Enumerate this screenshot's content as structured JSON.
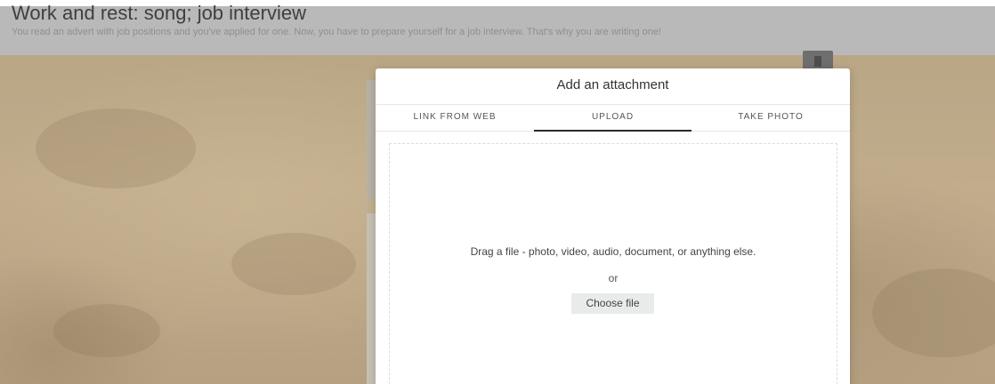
{
  "page": {
    "title": "Work and rest: song; job interview",
    "subtitle": "You read an advert with job positions and you've applied for one. Now, you have to prepare yourself for a job interview. That's why you are writing one!"
  },
  "modal": {
    "title": "Add an attachment",
    "tabs": [
      {
        "label": "LINK FROM WEB",
        "selected": false
      },
      {
        "label": "UPLOAD",
        "selected": true
      },
      {
        "label": "TAKE PHOTO",
        "selected": false
      }
    ],
    "drop_text": "Drag a file - photo, video, audio, document, or anything else.",
    "or_text": "or",
    "choose_label": "Choose file"
  },
  "colors": {
    "overlay": "#b9b9b9",
    "accent": "#2b2b2b",
    "button_bg": "#e8ebea"
  }
}
